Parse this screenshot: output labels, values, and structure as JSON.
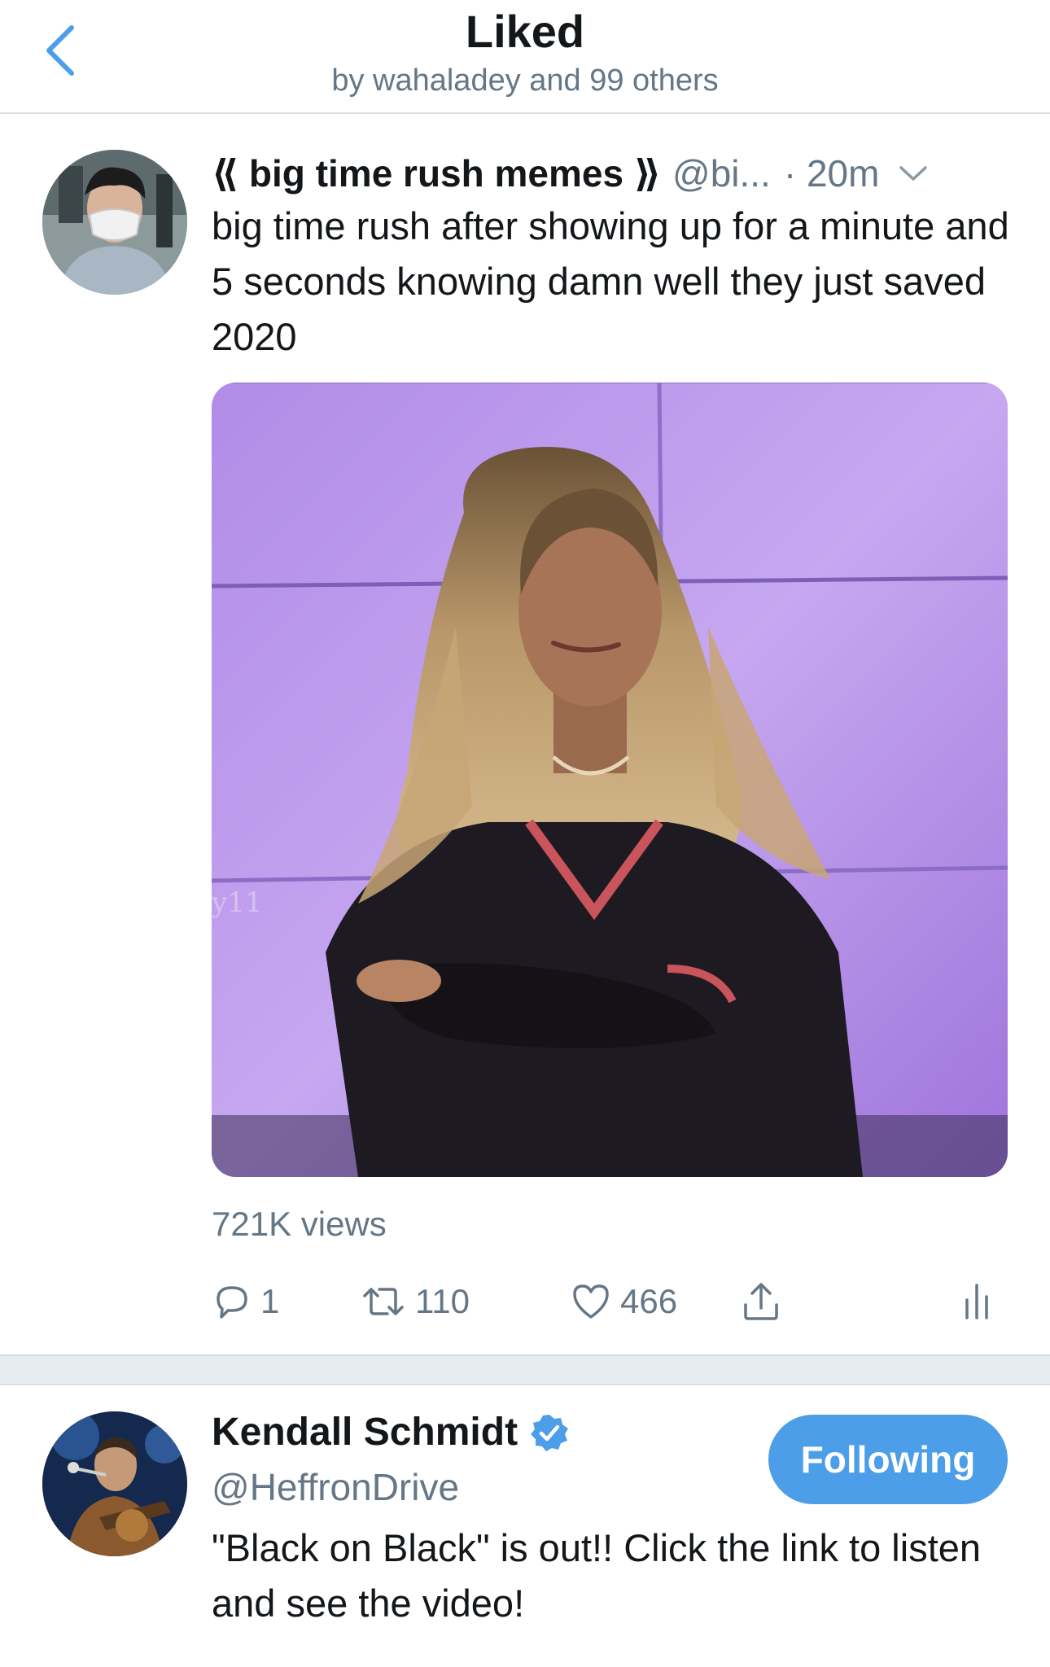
{
  "header": {
    "title": "Liked",
    "subtitle": "by wahaladey and 99 others"
  },
  "tweet": {
    "display_name": "⟪ big time rush memes ⟫",
    "handle": "@bi...",
    "time": "· 20m",
    "text": "big time rush after showing up for a minute and 5 seconds knowing damn well they just saved 2020",
    "media_watermark": "y11",
    "views": "721K views",
    "actions": {
      "replies": "1",
      "retweets": "110",
      "likes": "466"
    }
  },
  "user_card": {
    "name": "Kendall Schmidt",
    "handle": "@HeffronDrive",
    "follow_label": "Following",
    "bio": "\"Black on Black\" is out!! Click the link to listen and see the video!"
  },
  "colors": {
    "accent": "#4c9ee8",
    "secondary_text": "#657786",
    "separator": "#e6ecf0"
  },
  "icons": {
    "back": "chevron-left-icon",
    "caret": "chevron-down-icon",
    "reply": "reply-bubble-icon",
    "retweet": "retweet-icon",
    "like": "heart-icon",
    "share": "share-icon",
    "analytics": "analytics-icon",
    "verified": "verified-badge-icon"
  }
}
